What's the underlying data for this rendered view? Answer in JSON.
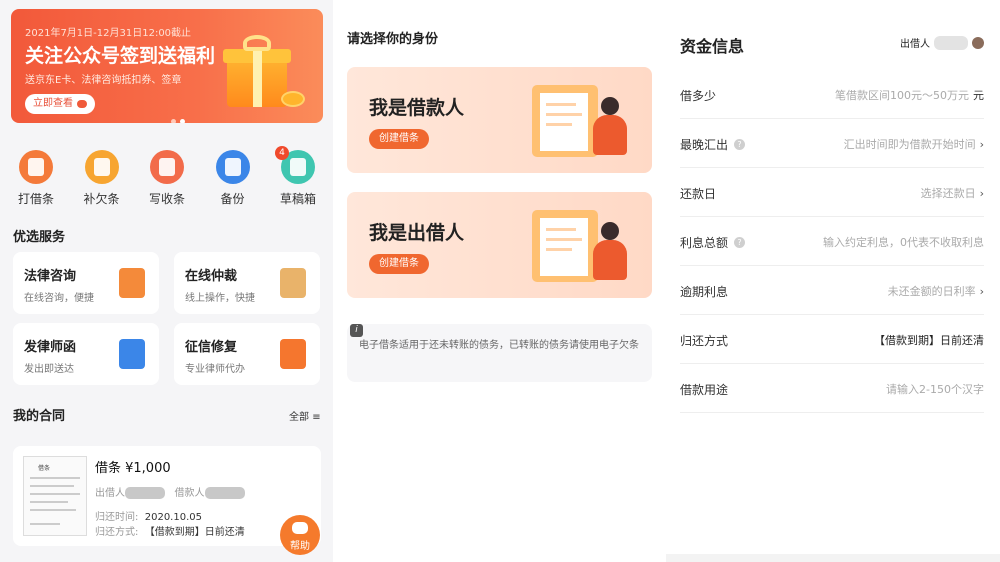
{
  "panel1": {
    "banner": {
      "date": "2021年7月1日-12月31日12:00截止",
      "title": "关注公众号签到送福利",
      "subtitle": "送京东E卡、法律咨询抵扣券、签章",
      "button": "立即查看"
    },
    "quick_actions": [
      {
        "label": "打借条",
        "color": "#f47a3a",
        "icon": "iou-icon"
      },
      {
        "label": "补欠条",
        "color": "#f7a531",
        "icon": "debt-note-icon"
      },
      {
        "label": "写收条",
        "color": "#f26b4a",
        "icon": "receipt-icon"
      },
      {
        "label": "备份",
        "color": "#3b86e8",
        "icon": "backup-icon"
      },
      {
        "label": "草稿箱",
        "color": "#3fc6b0",
        "icon": "drafts-icon",
        "badge": "4"
      }
    ],
    "services_title": "优选服务",
    "services": [
      {
        "name": "法律咨询",
        "desc": "在线咨询，便捷",
        "color": "#f48a3a"
      },
      {
        "name": "在线仲裁",
        "desc": "线上操作，快捷",
        "color": "#e9b36a"
      },
      {
        "name": "发律师函",
        "desc": "发出即送达",
        "color": "#3b86e8"
      },
      {
        "name": "征信修复",
        "desc": "专业律师代办",
        "color": "#f5762e"
      }
    ],
    "contracts_title": "我的合同",
    "all_link": "全部",
    "contract": {
      "thumb_title": "借条",
      "title": "借条 ¥1,000",
      "lender_label": "出借人",
      "borrower_label": "借款人",
      "return_time_label": "归还时间:",
      "return_time": "2020.10.05",
      "return_method_label": "归还方式:",
      "return_method": "【借款到期】日前还清"
    },
    "help": "帮助"
  },
  "panel2": {
    "title": "请选择你的身份",
    "roles": [
      {
        "title": "我是借款人",
        "button": "创建借条"
      },
      {
        "title": "我是出借人",
        "button": "创建借条"
      }
    ],
    "note": "电子借条适用于还未转账的债务，已转账的债务请使用电子欠条"
  },
  "panel3": {
    "title": "资金信息",
    "lender": "出借人",
    "rows": [
      {
        "key": "借多少",
        "value": "笔借款区间100元～50万元",
        "unit": "元",
        "help": false,
        "arrow": false,
        "dark": false
      },
      {
        "key": "最晚汇出",
        "value": "汇出时间即为借款开始时间",
        "help": true,
        "arrow": true,
        "dark": false
      },
      {
        "key": "还款日",
        "value": "选择还款日",
        "help": false,
        "arrow": true,
        "dark": false
      },
      {
        "key": "利息总额",
        "value": "输入约定利息，0代表不收取利息",
        "help": true,
        "arrow": false,
        "dark": false
      },
      {
        "key": "逾期利息",
        "value": "未还金额的日利率",
        "help": false,
        "arrow": true,
        "dark": false
      },
      {
        "key": "归还方式",
        "value": "【借款到期】日前还清",
        "help": false,
        "arrow": false,
        "dark": true
      },
      {
        "key": "借款用途",
        "value": "请输入2-150个汉字",
        "help": false,
        "arrow": false,
        "dark": false
      }
    ]
  }
}
